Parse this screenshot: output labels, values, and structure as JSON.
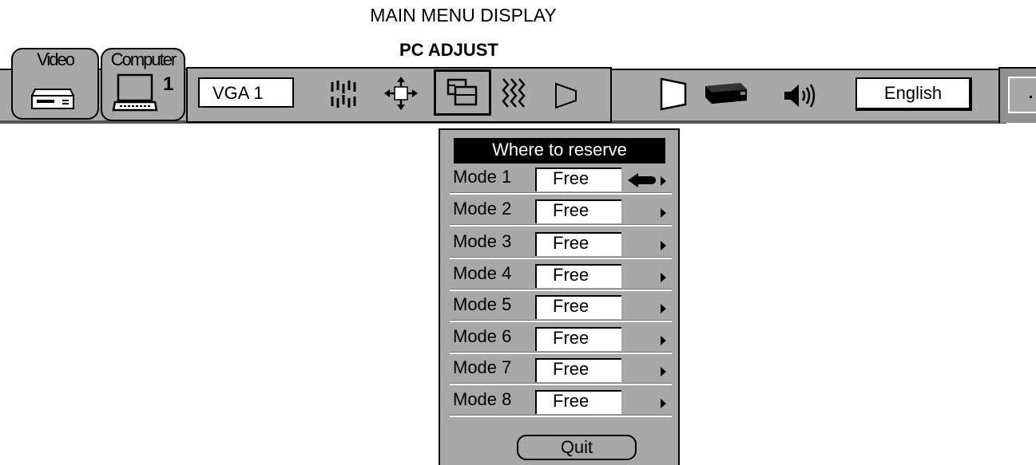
{
  "header": {
    "page_title": "MAIN MENU DISPLAY",
    "section_title": "PC ADJUST"
  },
  "tabs": [
    {
      "label": "Video",
      "icon": "vcr-icon",
      "selected": false
    },
    {
      "label": "Computer",
      "icon": "laptop-icon",
      "badge": "1",
      "selected": true
    }
  ],
  "toolbar": {
    "input_source": "VGA 1",
    "icons": [
      "fine-sync-icon",
      "position-icon",
      "pc-adjust-icon",
      "image-level-icon",
      "screen-icon"
    ],
    "selected_icon": "pc-adjust-icon",
    "extra_icons": [
      "screen-icon",
      "projector-icon",
      "volume-icon"
    ],
    "language": "English"
  },
  "dialog": {
    "title": "Where to reserve",
    "modes": [
      {
        "label": "Mode 1",
        "value": "Free",
        "pointer": true
      },
      {
        "label": "Mode 2",
        "value": "Free"
      },
      {
        "label": "Mode 3",
        "value": "Free"
      },
      {
        "label": "Mode 4",
        "value": "Free"
      },
      {
        "label": "Mode 5",
        "value": "Free"
      },
      {
        "label": "Mode 6",
        "value": "Free"
      },
      {
        "label": "Mode 7",
        "value": "Free"
      },
      {
        "label": "Mode 8",
        "value": "Free"
      }
    ],
    "quit_label": "Quit"
  },
  "colors": {
    "panel_gray": "#a8a8a8",
    "title_bg": "#000000",
    "title_fg": "#ffffff"
  }
}
